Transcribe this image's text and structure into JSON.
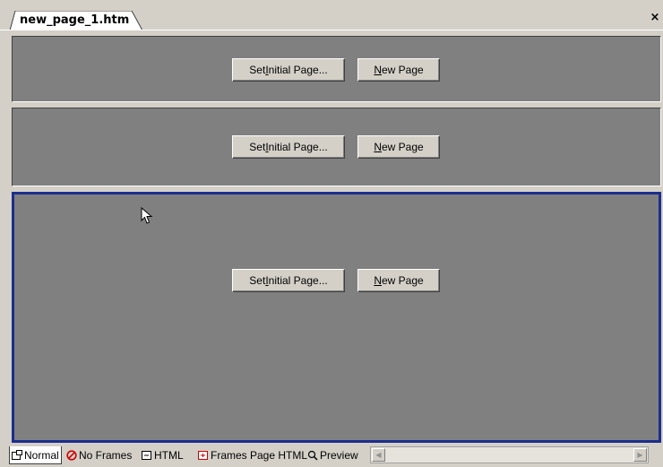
{
  "tab": {
    "title": "new_page_1.htm",
    "close_glyph": "×"
  },
  "frames": [
    {
      "set_prefix": "Set ",
      "set_mnemonic": "I",
      "set_suffix": "nitial Page...",
      "new_mnemonic": "N",
      "new_suffix": "ew Page"
    },
    {
      "set_prefix": "Set ",
      "set_mnemonic": "I",
      "set_suffix": "nitial Page...",
      "new_mnemonic": "N",
      "new_suffix": "ew Page"
    },
    {
      "set_prefix": "Set ",
      "set_mnemonic": "I",
      "set_suffix": "nitial Page...",
      "new_mnemonic": "N",
      "new_suffix": "ew Page"
    }
  ],
  "selected_frame": 3,
  "colors": {
    "frame_bg": "#808080",
    "selected_border": "#1c2e8c",
    "chrome": "#d4d0c8"
  },
  "view_tabs": [
    {
      "label": "Normal",
      "icon": "normal-view-icon",
      "active": true
    },
    {
      "label": "No Frames",
      "icon": "no-frames-icon",
      "active": false
    },
    {
      "label": "HTML",
      "icon": "html-icon",
      "active": false
    },
    {
      "label": "Frames Page HTML",
      "icon": "frames-page-html-icon",
      "active": false
    },
    {
      "label": "Preview",
      "icon": "preview-icon",
      "active": false
    }
  ]
}
